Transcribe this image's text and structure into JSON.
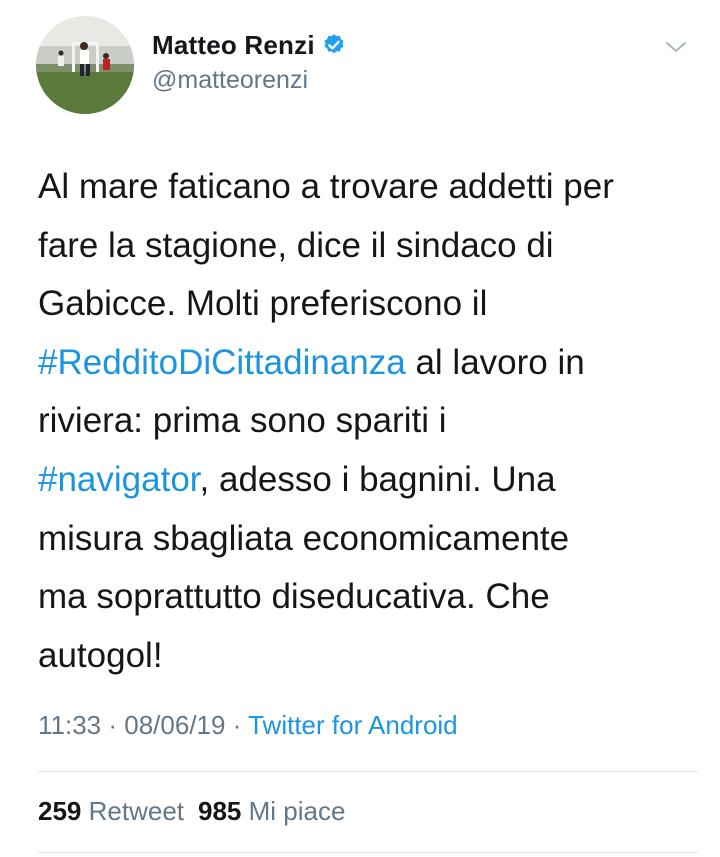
{
  "author": {
    "name": "Matteo Renzi",
    "handle": "@matteorenzi",
    "verified": true,
    "avatar_icon": "avatar-photo"
  },
  "tweet": {
    "lines": [
      [
        {
          "text": "Al mare faticano a trovare addetti per",
          "type": "text"
        }
      ],
      [
        {
          "text": "fare la stagione, dice il sindaco di",
          "type": "text"
        }
      ],
      [
        {
          "text": "Gabicce. Molti preferiscono il",
          "type": "text"
        }
      ],
      [
        {
          "text": "#RedditoDiCittadinanza",
          "type": "hashtag"
        },
        {
          "text": " al lavoro in",
          "type": "text"
        }
      ],
      [
        {
          "text": "riviera: prima sono spariti i",
          "type": "text"
        }
      ],
      [
        {
          "text": "#navigator",
          "type": "hashtag"
        },
        {
          "text": ", adesso i bagnini. Una",
          "type": "text"
        }
      ],
      [
        {
          "text": "misura sbagliata economicamente",
          "type": "text"
        }
      ],
      [
        {
          "text": "ma soprattutto diseducativa. Che",
          "type": "text"
        }
      ],
      [
        {
          "text": "autogol!",
          "type": "text"
        }
      ]
    ]
  },
  "meta": {
    "time": "11:33",
    "separator1": " · ",
    "date": "08/06/19",
    "separator2": " · ",
    "source": "Twitter for Android"
  },
  "stats": {
    "retweets_count": "259",
    "retweets_label": "Retweet",
    "likes_count": "985",
    "likes_label": "Mi piace"
  },
  "colors": {
    "text": "#14171a",
    "secondary": "#657786",
    "link": "#1b95e0",
    "verified": "#1da1f2"
  },
  "icons": {
    "verified": "verified-badge-icon",
    "menu": "chevron-down-icon"
  }
}
